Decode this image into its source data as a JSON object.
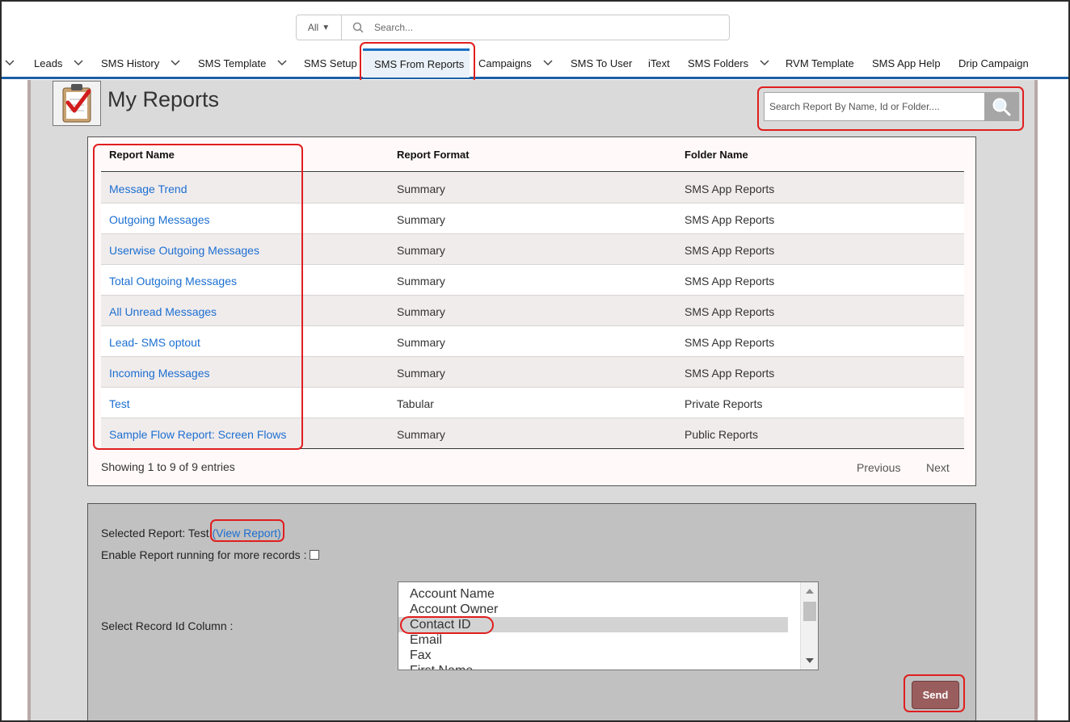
{
  "global_search": {
    "scope": "All",
    "placeholder": "Search..."
  },
  "nav": {
    "items": [
      {
        "label": "Leads",
        "dropdown": true
      },
      {
        "label": "SMS History",
        "dropdown": true
      },
      {
        "label": "SMS Template",
        "dropdown": true
      },
      {
        "label": "SMS Setup",
        "dropdown": false
      },
      {
        "label": "SMS From Reports",
        "dropdown": false,
        "active": true
      },
      {
        "label": "Campaigns",
        "dropdown": true
      },
      {
        "label": "SMS To User",
        "dropdown": false
      },
      {
        "label": "iText",
        "dropdown": false
      },
      {
        "label": "SMS Folders",
        "dropdown": true
      },
      {
        "label": "RVM Template",
        "dropdown": false
      },
      {
        "label": "SMS App Help",
        "dropdown": false
      },
      {
        "label": "Drip Campaign",
        "dropdown": false
      }
    ]
  },
  "page": {
    "title": "My Reports",
    "search_placeholder": "Search Report By Name, Id or Folder...."
  },
  "table": {
    "columns": [
      "Report Name",
      "Report Format",
      "Folder Name"
    ],
    "rows": [
      [
        "Message Trend",
        "Summary",
        "SMS App Reports"
      ],
      [
        "Outgoing Messages",
        "Summary",
        "SMS App Reports"
      ],
      [
        "Userwise Outgoing Messages",
        "Summary",
        "SMS App Reports"
      ],
      [
        "Total Outgoing Messages",
        "Summary",
        "SMS App Reports"
      ],
      [
        "All Unread Messages",
        "Summary",
        "SMS App Reports"
      ],
      [
        "Lead- SMS optout",
        "Summary",
        "SMS App Reports"
      ],
      [
        "Incoming Messages",
        "Summary",
        "SMS App Reports"
      ],
      [
        "Test",
        "Tabular",
        "Private Reports"
      ],
      [
        "Sample Flow Report: Screen Flows",
        "Summary",
        "Public Reports"
      ]
    ],
    "showing": "Showing 1 to 9 of 9 entries",
    "previous": "Previous",
    "next": "Next"
  },
  "selection": {
    "selected_label": "Selected Report: Test ",
    "view_report": "(View Report)",
    "enable_label": "Enable Report running for more records :",
    "record_id_label": "Select Record Id Column :",
    "options": [
      "Account Name",
      "Account Owner",
      "Contact ID",
      "Email",
      "Fax",
      "First Name"
    ],
    "selected_option": "Contact ID",
    "send_label": "Send"
  },
  "colors": {
    "accent": "#1b6fd1",
    "annotation": "#e01e1e",
    "send": "#9a5d5d"
  },
  "icons": {
    "search": "search-icon",
    "report_logo": "clipboard-check-icon"
  }
}
